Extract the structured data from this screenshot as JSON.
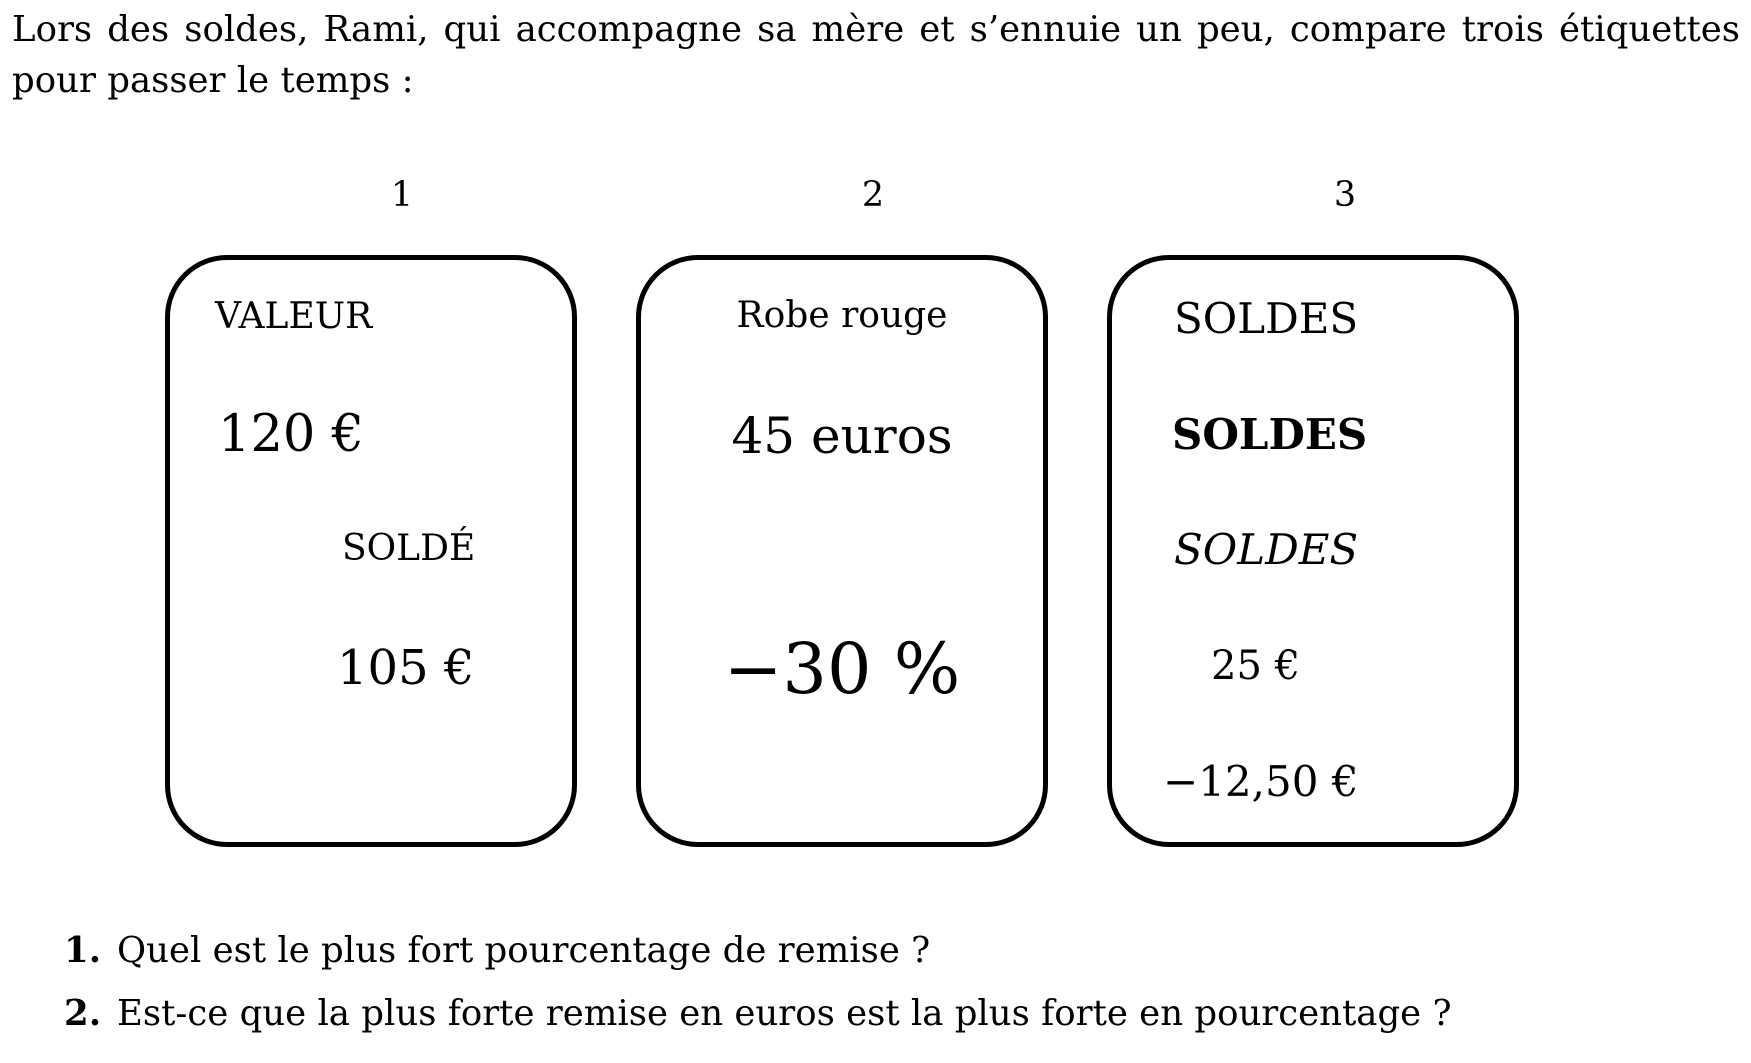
{
  "intro": "Lors des soldes, Rami, qui accompagne sa mère et s’ennuie un peu, compare trois étiquettes pour passer le temps :",
  "tags": [
    {
      "number": "1",
      "lines": [
        "VALEUR",
        "120 €",
        "SOLDÉ",
        "105 €"
      ]
    },
    {
      "number": "2",
      "lines": [
        "Robe rouge",
        "45 euros",
        "−30 %"
      ]
    },
    {
      "number": "3",
      "lines": [
        "SOLDES",
        "SOLDES",
        "SOLDES",
        "25 €",
        "−12,50 €"
      ]
    }
  ],
  "questions": [
    {
      "number": "1.",
      "text": "Quel est le plus fort pourcentage de remise ?"
    },
    {
      "number": "2.",
      "text": "Est-ce que la plus forte remise en euros est la plus forte en pourcentage ?"
    }
  ]
}
